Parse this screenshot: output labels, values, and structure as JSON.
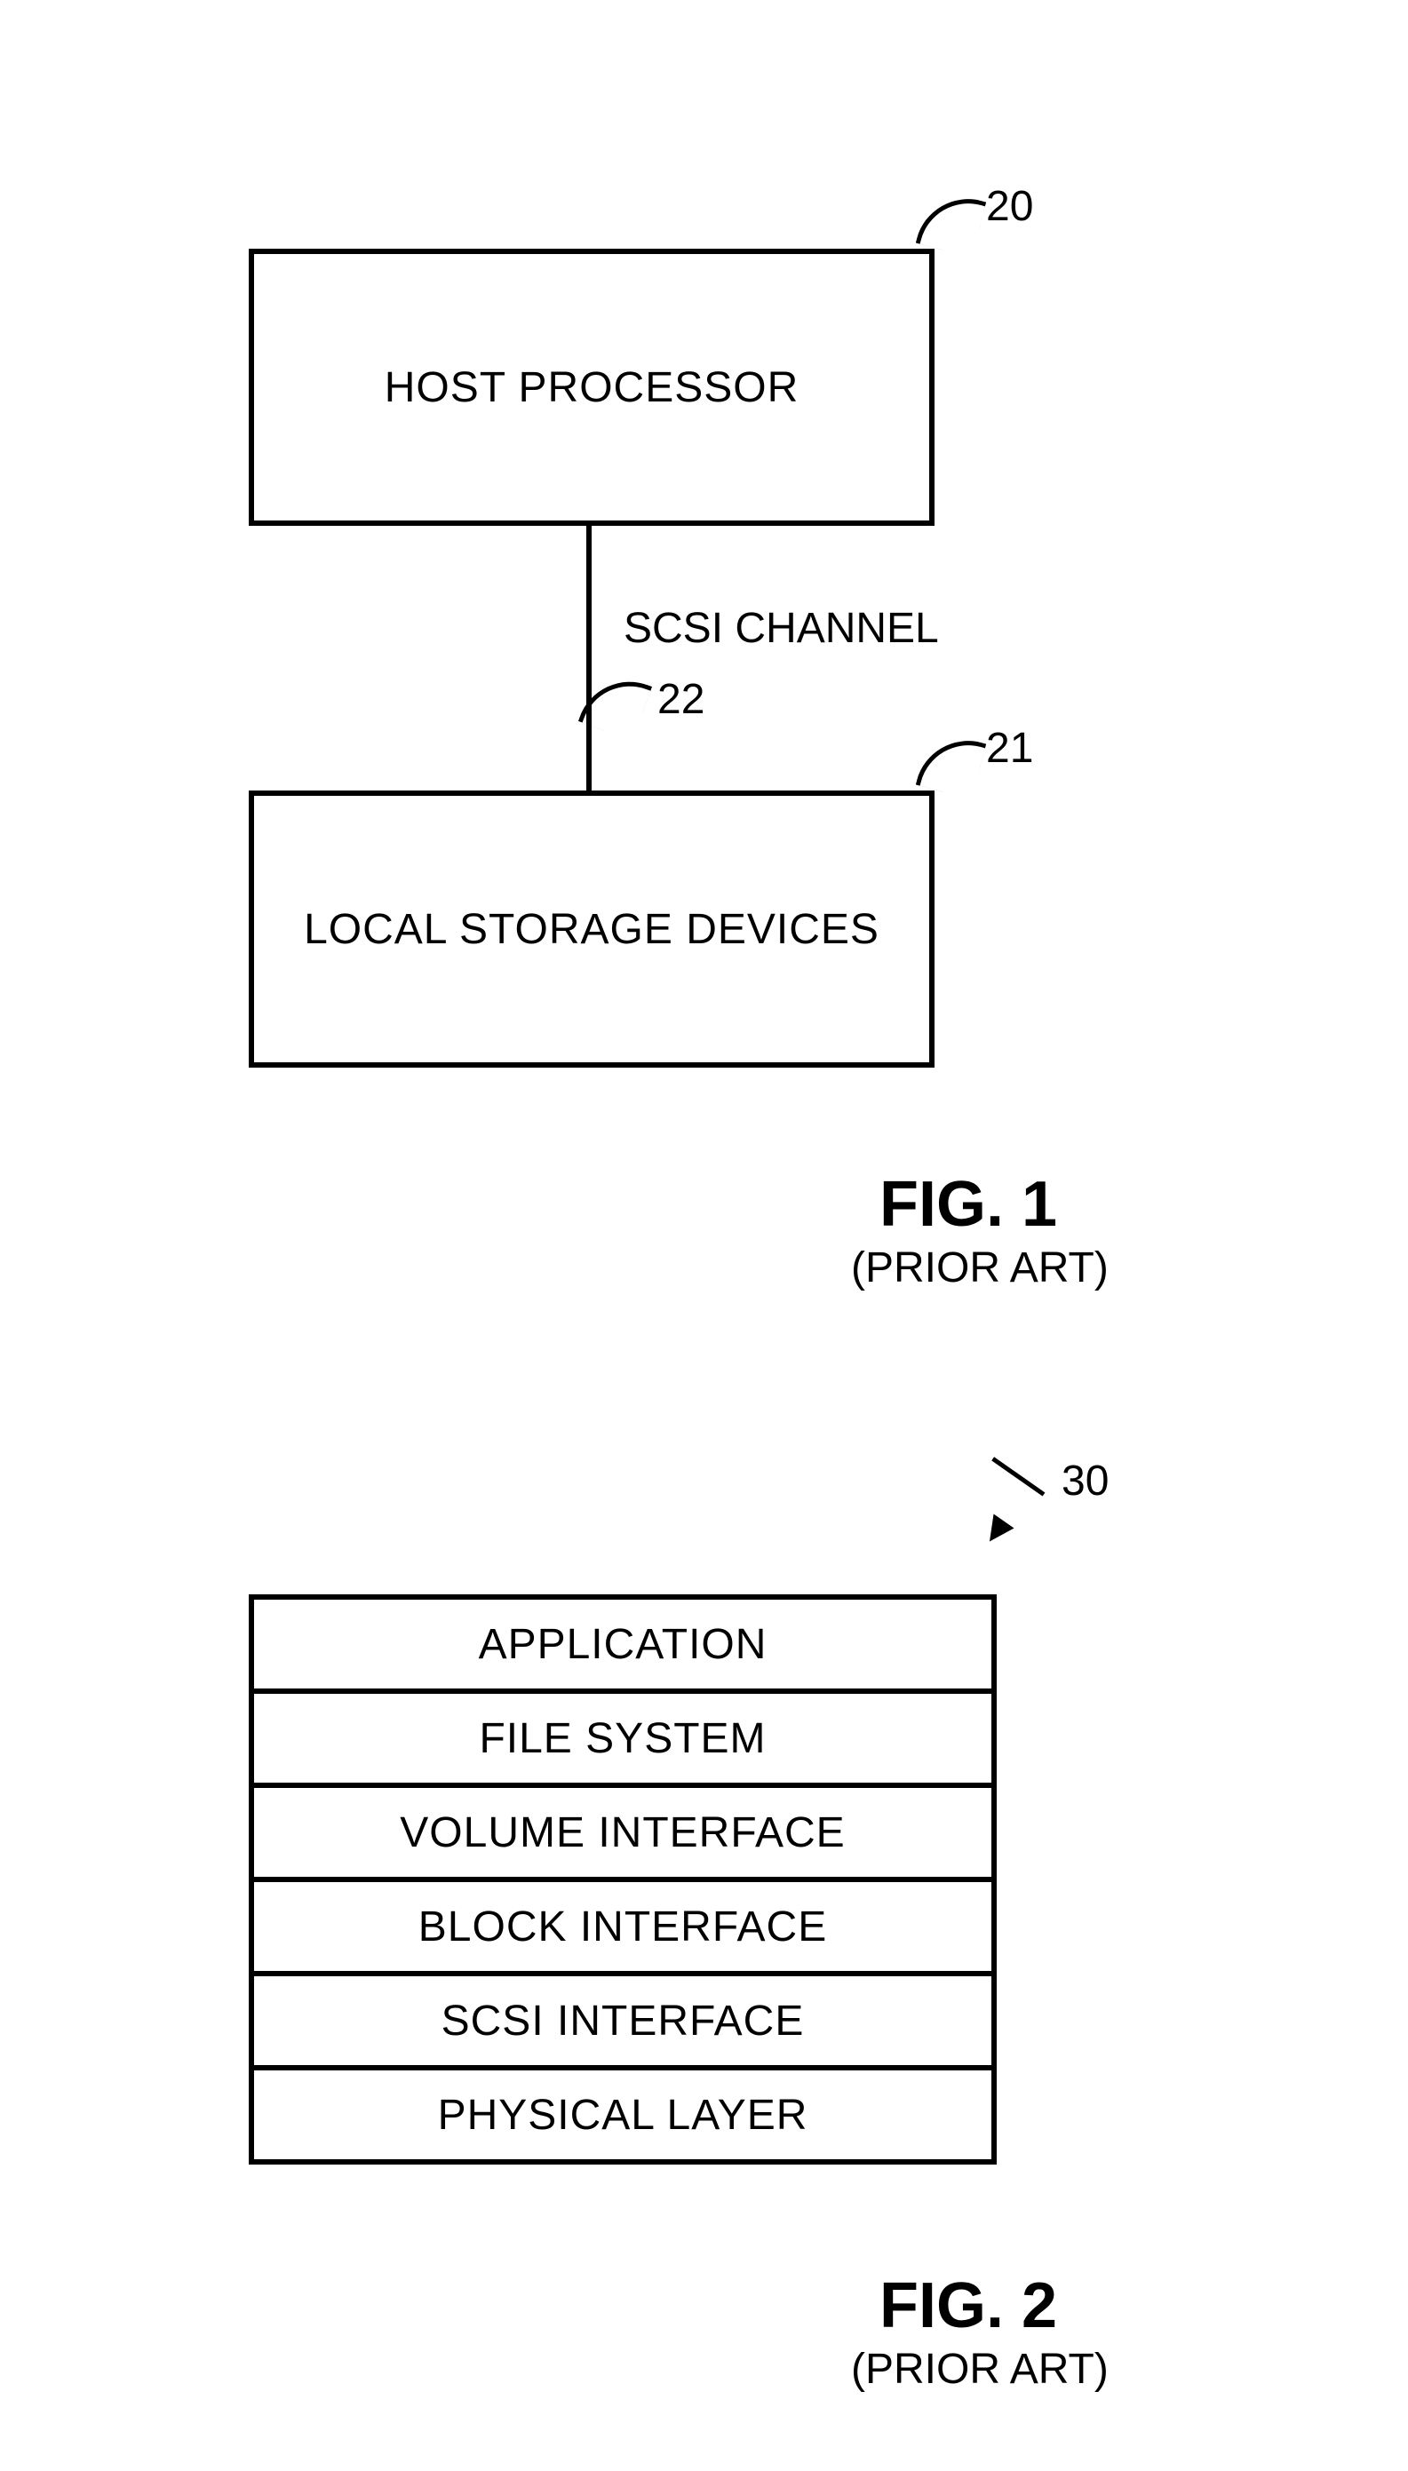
{
  "fig1": {
    "host_box": "HOST PROCESSOR",
    "storage_box": "LOCAL STORAGE DEVICES",
    "channel_label": "SCSI CHANNEL",
    "ref20": "20",
    "ref21": "21",
    "ref22": "22",
    "title": "FIG. 1",
    "subtitle": "(PRIOR ART)"
  },
  "fig2": {
    "ref30": "30",
    "layers": [
      "APPLICATION",
      "FILE SYSTEM",
      "VOLUME INTERFACE",
      "BLOCK INTERFACE",
      "SCSI INTERFACE",
      "PHYSICAL LAYER"
    ],
    "title": "FIG. 2",
    "subtitle": "(PRIOR ART)"
  }
}
